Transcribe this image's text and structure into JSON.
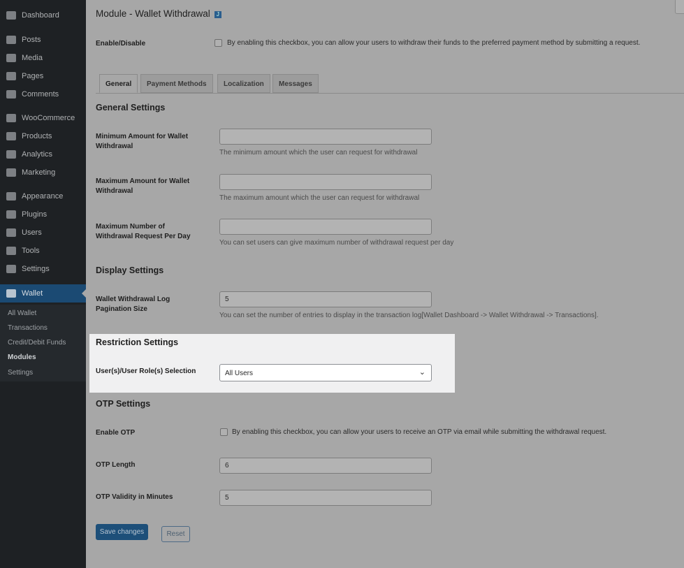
{
  "sidebar": {
    "items": [
      "Dashboard",
      "Posts",
      "Media",
      "Pages",
      "Comments",
      "WooCommerce",
      "Products",
      "Analytics",
      "Marketing",
      "Appearance",
      "Plugins",
      "Users",
      "Tools",
      "Settings",
      "Wallet"
    ],
    "submenu": [
      "All Wallet",
      "Transactions",
      "Credit/Debit Funds",
      "Modules",
      "Settings"
    ]
  },
  "page": {
    "title": "Module - Wallet Withdrawal",
    "badge": "J",
    "enable_label": "Enable/Disable",
    "enable_desc": "By enabling this checkbox, you can allow your users to withdraw their funds to the preferred payment method by submitting a request.",
    "tabs": [
      "General",
      "Payment Methods",
      "Localization",
      "Messages"
    ],
    "general_heading": "General Settings",
    "min_label": "Minimum Amount for Wallet Withdrawal",
    "min_value": "",
    "min_desc": "The minimum amount which the user can request for withdrawal",
    "max_label": "Maximum Amount for Wallet Withdrawal",
    "max_value": "",
    "max_desc": "The maximum amount which the user can request for withdrawal",
    "maxreq_label": "Maximum Number of Withdrawal Request Per Day",
    "maxreq_value": "",
    "maxreq_desc": "You can set users can give maximum number of withdrawal request per day",
    "display_heading": "Display Settings",
    "pag_label": "Wallet Withdrawal Log Pagination Size",
    "pag_value": "5",
    "pag_desc": "You can set the number of entries to display in the transaction log[Wallet Dashboard -> Wallet Withdrawal -> Transactions].",
    "restriction_heading": "Restriction Settings",
    "role_label": "User(s)/User Role(s) Selection",
    "role_value": "All Users",
    "otp_heading": "OTP Settings",
    "otp_enable_label": "Enable OTP",
    "otp_enable_desc": "By enabling this checkbox, you can allow your users to receive an OTP via email while submitting the withdrawal request.",
    "otp_len_label": "OTP Length",
    "otp_len_value": "6",
    "otp_val_label": "OTP Validity in Minutes",
    "otp_val_value": "5",
    "save": "Save changes",
    "reset": "Reset"
  }
}
